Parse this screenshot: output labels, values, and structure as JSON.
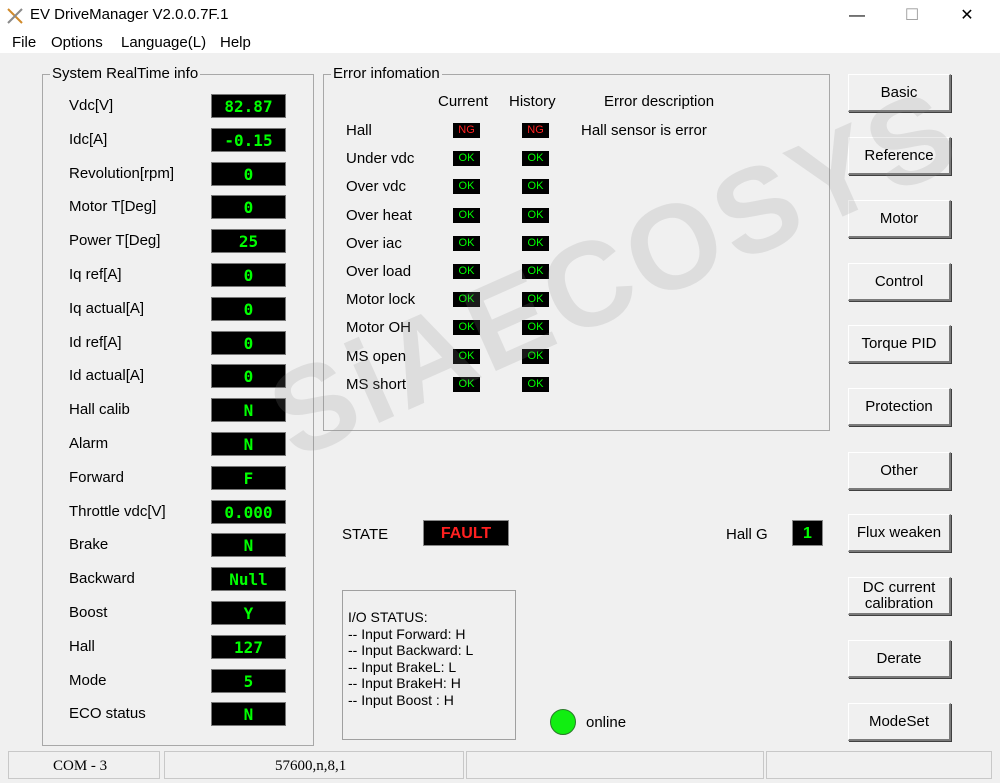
{
  "window": {
    "title": "EV DriveManager V2.0.0.7F.1",
    "minimize": "—",
    "maximize": "☐",
    "close": "✕"
  },
  "menu": [
    {
      "label": "File"
    },
    {
      "label": "Options"
    },
    {
      "label": "Language(L)"
    },
    {
      "label": "Help"
    }
  ],
  "realtime": {
    "title": "System RealTime info",
    "rows": [
      {
        "label": "Vdc[V]",
        "value": "82.87"
      },
      {
        "label": "Idc[A]",
        "value": "-0.15"
      },
      {
        "label": "Revolution[rpm]",
        "value": "0"
      },
      {
        "label": "Motor T[Deg]",
        "value": "0"
      },
      {
        "label": "Power T[Deg]",
        "value": "25"
      },
      {
        "label": "Iq ref[A]",
        "value": "0"
      },
      {
        "label": "Iq actual[A]",
        "value": "0"
      },
      {
        "label": "Id ref[A]",
        "value": "0"
      },
      {
        "label": "Id actual[A]",
        "value": "0"
      },
      {
        "label": "Hall calib",
        "value": "N"
      },
      {
        "label": "Alarm",
        "value": "N"
      },
      {
        "label": "Forward",
        "value": "F"
      },
      {
        "label": "Throttle vdc[V]",
        "value": "0.000"
      },
      {
        "label": "Brake",
        "value": "N"
      },
      {
        "label": "Backward",
        "value": "Null"
      },
      {
        "label": "Boost",
        "value": "Y"
      },
      {
        "label": "Hall",
        "value": "127"
      },
      {
        "label": "Mode",
        "value": "5"
      },
      {
        "label": "ECO status",
        "value": "N"
      }
    ]
  },
  "errors": {
    "title": "Error infomation",
    "col_current": "Current",
    "col_history": "History",
    "col_desc": "Error description",
    "rows": [
      {
        "label": "Hall",
        "current": "NG",
        "history": "NG",
        "desc": "Hall sensor is error"
      },
      {
        "label": "Under vdc",
        "current": "OK",
        "history": "OK",
        "desc": ""
      },
      {
        "label": "Over vdc",
        "current": "OK",
        "history": "OK",
        "desc": ""
      },
      {
        "label": "Over heat",
        "current": "OK",
        "history": "OK",
        "desc": ""
      },
      {
        "label": "Over iac",
        "current": "OK",
        "history": "OK",
        "desc": ""
      },
      {
        "label": "Over load",
        "current": "OK",
        "history": "OK",
        "desc": ""
      },
      {
        "label": "Motor lock",
        "current": "OK",
        "history": "OK",
        "desc": ""
      },
      {
        "label": "Motor OH",
        "current": "OK",
        "history": "OK",
        "desc": ""
      },
      {
        "label": "MS open",
        "current": "OK",
        "history": "OK",
        "desc": ""
      },
      {
        "label": "MS short",
        "current": "OK",
        "history": "OK",
        "desc": ""
      }
    ]
  },
  "state": {
    "label": "STATE",
    "value": "FAULT"
  },
  "hall_g": {
    "label": "Hall G",
    "value": "1"
  },
  "io_status": {
    "title": "I/O STATUS:",
    "lines": [
      "--  Input Forward: H",
      "--  Input Backward: L",
      "--  Input BrakeL: L",
      "--  Input BrakeH: H",
      "--  Input Boost : H"
    ]
  },
  "connection": {
    "label": "online",
    "led_color": "#11ee11"
  },
  "buttons": [
    {
      "label": "Basic"
    },
    {
      "label": "Reference"
    },
    {
      "label": "Motor"
    },
    {
      "label": "Control"
    },
    {
      "label": "Torque PID"
    },
    {
      "label": "Protection"
    },
    {
      "label": "Other"
    },
    {
      "label": "Flux weaken"
    },
    {
      "label": "DC current calibration"
    },
    {
      "label": "Derate"
    },
    {
      "label": "ModeSet"
    }
  ],
  "statusbar": {
    "port": "COM - 3",
    "settings": "57600,n,8,1"
  },
  "watermark": "SiAECOSYS",
  "colors": {
    "ok": "#00ff00",
    "ng": "#ff2020",
    "value_bg": "#000000"
  }
}
